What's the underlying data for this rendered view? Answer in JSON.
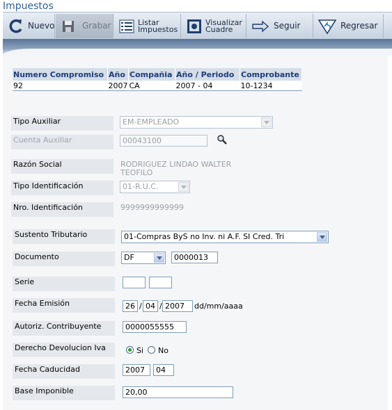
{
  "page": {
    "title": "Impuestos"
  },
  "toolbar": {
    "nuevo": "Nuevo",
    "grabar": "Grabar",
    "listar_1": "Listar",
    "listar_2": "Impuestos",
    "visualizar_1": "Visualizar",
    "visualizar_2": "Cuadre",
    "seguir": "Seguir",
    "regresar": "Regresar"
  },
  "info_table": {
    "headers": [
      "Numero Compromiso",
      "Año",
      "Compañia",
      "Año / Periodo",
      "Comprobante"
    ],
    "row": [
      "92",
      "2007",
      "CA",
      "2007 - 04",
      "10-1234"
    ]
  },
  "form": {
    "tipo_auxiliar": {
      "label": "Tipo Auxiliar",
      "value": "EM-EMPLEADO"
    },
    "cuenta_auxiliar": {
      "label": "Cuenta Auxiliar",
      "value": "00043100"
    },
    "razon_social": {
      "label": "Razón Social",
      "value_1": "RODRIGUEZ LINDAO WALTER",
      "value_2": "TEOFILO"
    },
    "tipo_identificacion": {
      "label": "Tipo Identificación",
      "value": "01-R.U.C."
    },
    "nro_identificacion": {
      "label": "Nro. Identificación",
      "value": "9999999999999"
    },
    "sustento_tributario": {
      "label": "Sustento Tributario",
      "value": "01-Compras ByS no Inv. ni A.F. SI Cred. Tri"
    },
    "documento": {
      "label": "Documento",
      "tipo": "DF",
      "numero": "0000013"
    },
    "serie": {
      "label": "Serie",
      "v1": "",
      "v2": ""
    },
    "fecha_emision": {
      "label": "Fecha Emisión",
      "dia": "26",
      "mes": "04",
      "anio": "2007",
      "sep": "/",
      "formato": "dd/mm/aaaa"
    },
    "autoriz": {
      "label": "Autoriz. Contribuyente",
      "value": "0000055555"
    },
    "devolucion_iva": {
      "label": "Derecho Devolucion Iva",
      "si": "Si",
      "no": "No",
      "selected": "Si"
    },
    "fecha_caducidad": {
      "label": "Fecha Caducidad",
      "anio": "2007",
      "mes": "04"
    },
    "base_imponible": {
      "label": "Base Imponible",
      "value": "20,00"
    }
  }
}
